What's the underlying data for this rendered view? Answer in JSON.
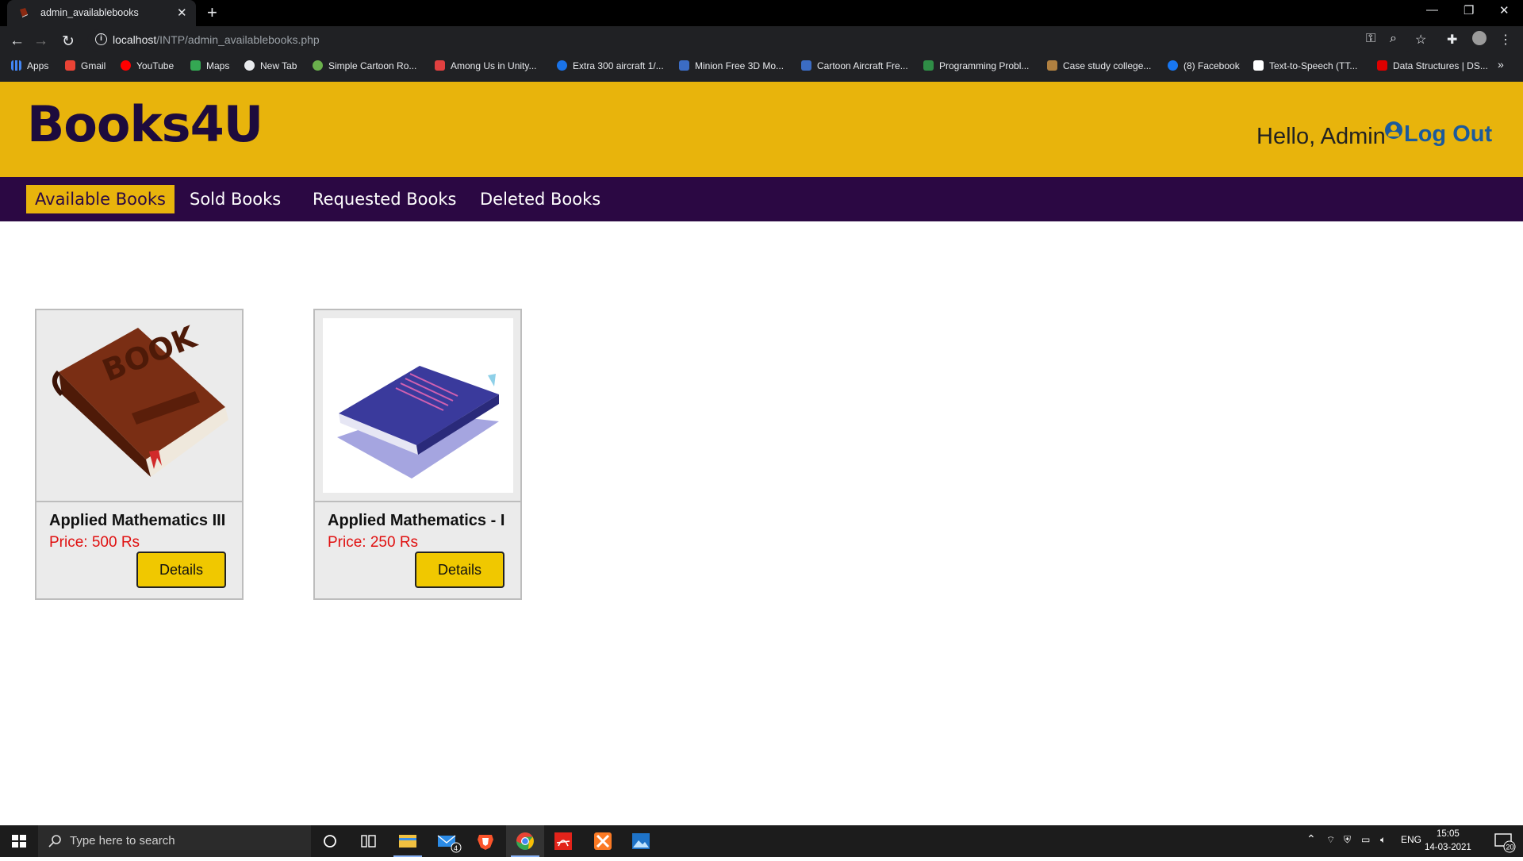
{
  "browser": {
    "tab_title": "admin_availablebooks",
    "url_host": "localhost",
    "url_path": "/INTP/admin_availablebooks.php",
    "bookmarks": [
      "Apps",
      "Gmail",
      "YouTube",
      "Maps",
      "New Tab",
      "Simple Cartoon Ro...",
      "Among Us in Unity...",
      "Extra 300 aircraft 1/...",
      "Minion Free 3D Mo...",
      "Cartoon Aircraft Fre...",
      "Programming Probl...",
      "Case study college...",
      "(8) Facebook",
      "Text-to-Speech (TT...",
      "Data Structures | DS..."
    ]
  },
  "site": {
    "logo": "Books4U",
    "greeting": "Hello, Admin",
    "logout": "Log Out",
    "menu": [
      "Available Books",
      "Sold Books",
      "Requested Books",
      "Deleted Books"
    ],
    "books": [
      {
        "title": "Applied Mathematics III",
        "price": "Price: 500 Rs",
        "button": "Details"
      },
      {
        "title": "Applied Mathematics - I",
        "price": "Price: 250 Rs",
        "button": "Details"
      }
    ]
  },
  "taskbar": {
    "search_placeholder": "Type here to search",
    "mail_badge": "4",
    "language": "ENG",
    "time": "15:05",
    "date": "14-03-2021",
    "notifications": "20"
  }
}
